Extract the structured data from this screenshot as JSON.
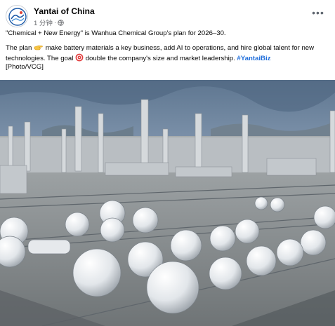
{
  "post": {
    "author": "Yantai of China",
    "time": "1 分钟",
    "separator": "·",
    "more_label": "•••",
    "headline": "\"Chemical + New Energy\" is Wanhua Chemical Group's plan for 2026–30.",
    "body": {
      "part1": "The plan",
      "part2": "make battery materials a key business, add AI to operations, and hire global talent for new technologies. The goal",
      "part3": "double the company's size and market leadership.",
      "hashtag": "#YantaiBiz",
      "credit": "[Photo/VCG]"
    },
    "emojis": [
      "pointing-hand-icon",
      "target-icon"
    ]
  },
  "colors": {
    "name": "#050505",
    "meta": "#65676b",
    "hashtag": "#216fdb",
    "sky": "#8fa3bd"
  }
}
